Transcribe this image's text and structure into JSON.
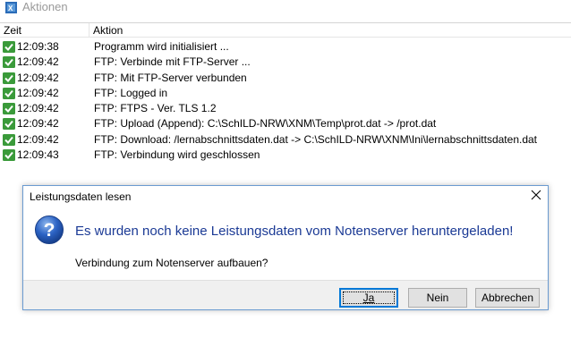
{
  "window": {
    "title": "Aktionen",
    "icon": "app-icon"
  },
  "list": {
    "columns": {
      "zeit": "Zeit",
      "aktion": "Aktion"
    },
    "rows": [
      {
        "icon": "check-icon",
        "zeit": "12:09:38",
        "aktion": "Programm wird initialisiert ..."
      },
      {
        "icon": "check-icon",
        "zeit": "12:09:42",
        "aktion": "FTP: Verbinde mit FTP-Server ..."
      },
      {
        "icon": "check-icon",
        "zeit": "12:09:42",
        "aktion": "FTP: Mit FTP-Server verbunden"
      },
      {
        "icon": "check-icon",
        "zeit": "12:09:42",
        "aktion": "FTP: Logged in"
      },
      {
        "icon": "check-icon",
        "zeit": "12:09:42",
        "aktion": "FTP: FTPS - Ver. TLS 1.2"
      },
      {
        "icon": "check-icon",
        "zeit": "12:09:42",
        "aktion": "FTP: Upload (Append): C:\\SchILD-NRW\\XNM\\Temp\\prot.dat -> /prot.dat"
      },
      {
        "icon": "check-icon",
        "zeit": "12:09:42",
        "aktion": "FTP: Download: /lernabschnittsdaten.dat -> C:\\SchILD-NRW\\XNM\\Ini\\lernabschnittsdaten.dat"
      },
      {
        "icon": "check-icon",
        "zeit": "12:09:43",
        "aktion": "FTP: Verbindung wird geschlossen"
      }
    ]
  },
  "dialog": {
    "title": "Leistungsdaten lesen",
    "main_instruction": "Es wurden noch keine Leistungsdaten vom Notenserver heruntergeladen!",
    "content": "Verbindung zum Notenserver aufbauen?",
    "buttons": {
      "ja": "Ja",
      "nein": "Nein",
      "abbrechen": "Abbrechen"
    },
    "accent_color": "#1b3a95"
  }
}
